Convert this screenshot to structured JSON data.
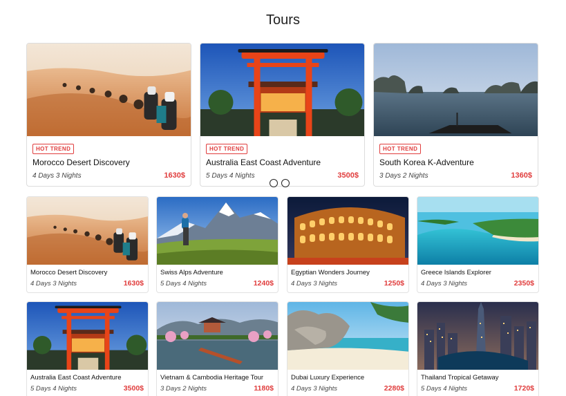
{
  "page": {
    "title": "Tours"
  },
  "featured": [
    {
      "name": "Morocco Desert Discovery",
      "badge": "HOT TREND",
      "duration": "4 Days 3 Nights",
      "price": "1630$",
      "image": "desert-camel-caravan"
    },
    {
      "name": "Australia East Coast Adventure",
      "badge": "HOT TREND",
      "duration": "5 Days 4 Nights",
      "price": "3500$",
      "image": "red-torii-gate"
    },
    {
      "name": "South Korea K-Adventure",
      "badge": "HOT TREND",
      "duration": "3 Days 2 Nights",
      "price": "1360$",
      "image": "limestone-bay"
    }
  ],
  "grid": [
    {
      "name": "Morocco Desert Discovery",
      "duration": "4 Days 3 Nights",
      "price": "1630$",
      "image": "desert-camel-caravan"
    },
    {
      "name": "Swiss Alps Adventure",
      "duration": "5 Days 4 Nights",
      "price": "1240$",
      "image": "alps-hiker"
    },
    {
      "name": "Egyptian Wonders Journey",
      "duration": "4 Days 3 Nights",
      "price": "1250$",
      "image": "colosseum-night"
    },
    {
      "name": "Greece Islands Explorer",
      "duration": "4 Days 3 Nights",
      "price": "2350$",
      "image": "turquoise-coast"
    },
    {
      "name": "Australia East Coast Adventure",
      "duration": "5 Days 4 Nights",
      "price": "3500$",
      "image": "red-torii-gate"
    },
    {
      "name": "Vietnam & Cambodia Heritage Tour",
      "duration": "3 Days 2 Nights",
      "price": "1180$",
      "image": "korean-pavilion"
    },
    {
      "name": "Dubai Luxury Experience",
      "duration": "4 Days 3 Nights",
      "price": "2280$",
      "image": "tropical-beach-rocks"
    },
    {
      "name": "Thailand Tropical Getaway",
      "duration": "5 Days 4 Nights",
      "price": "1720$",
      "image": "dubai-marina-night"
    }
  ],
  "colors": {
    "accent": "#e03c3c",
    "text": "#111111",
    "border": "#dcdcdc"
  }
}
